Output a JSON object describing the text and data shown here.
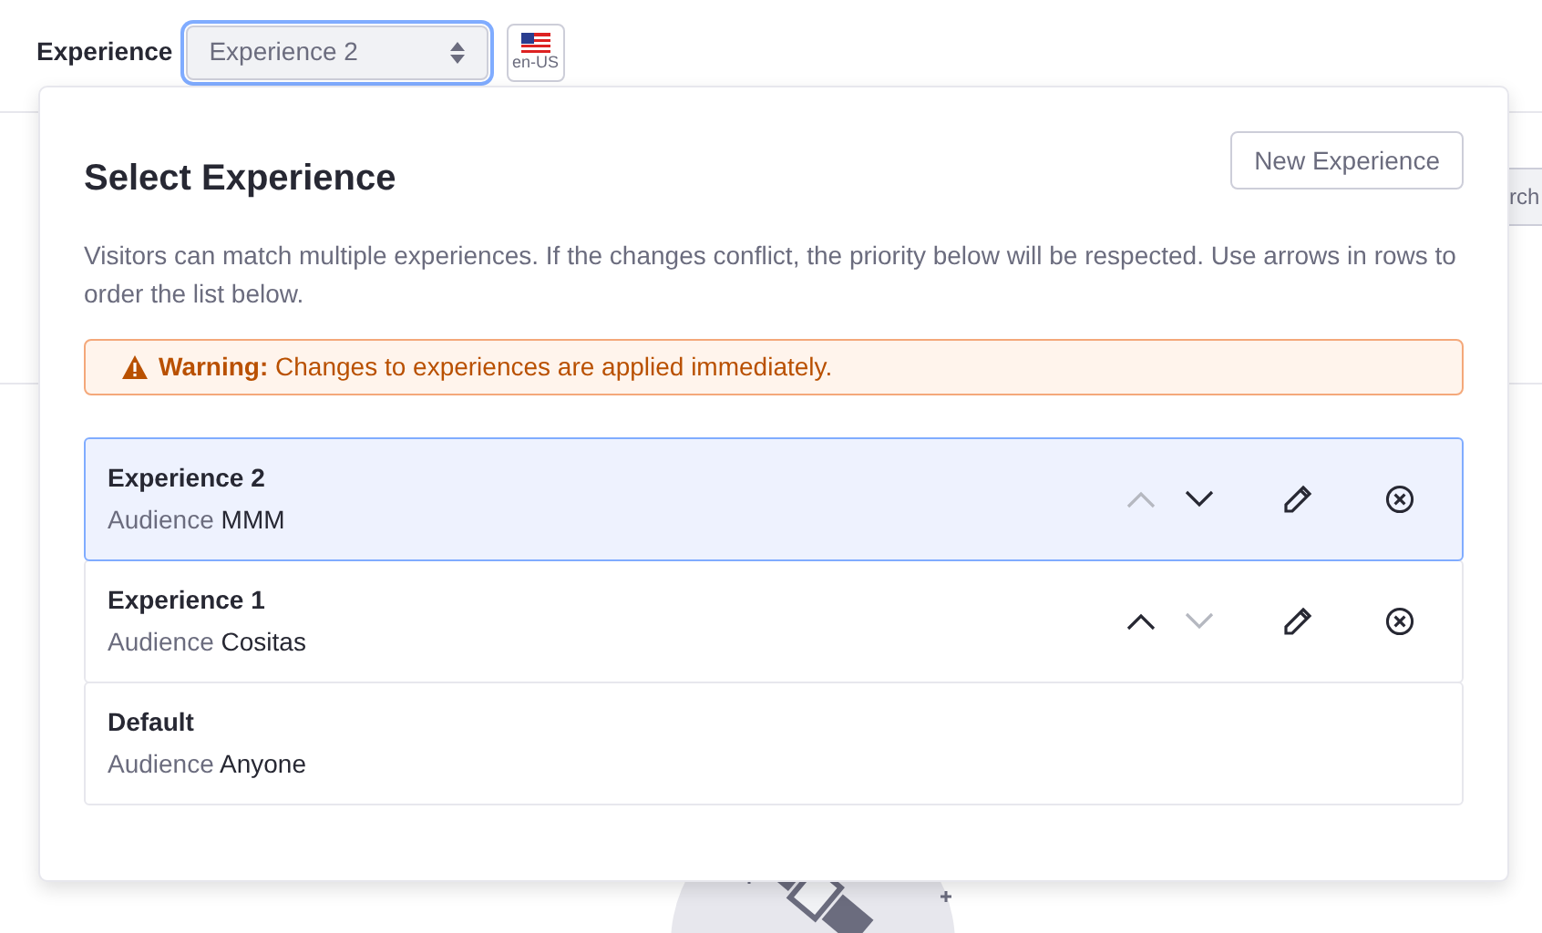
{
  "toolbar": {
    "label": "Experience",
    "select": {
      "value": "Experience 2"
    },
    "locale": {
      "label": "en-US"
    }
  },
  "background": {
    "button_fragment": "rch"
  },
  "popover": {
    "title": "Select Experience",
    "new_button": "New Experience",
    "description": "Visitors can match multiple experiences. If the changes conflict, the priority below will be respected. Use arrows in rows to order the list below.",
    "warning": {
      "label": "Warning:",
      "text": "Changes to experiences are applied immediately."
    },
    "rows": [
      {
        "kind": "experience",
        "name": "Experience 2",
        "audience_label": "Audience",
        "audience": "MMM",
        "selected": true,
        "up_disabled": true,
        "down_disabled": false
      },
      {
        "kind": "experience",
        "name": "Experience 1",
        "audience_label": "Audience",
        "audience": "Cositas",
        "selected": false,
        "up_disabled": false,
        "down_disabled": true
      },
      {
        "kind": "default",
        "name": "Default",
        "audience_label": "Audience",
        "audience": "Anyone",
        "selected": false
      }
    ]
  }
}
